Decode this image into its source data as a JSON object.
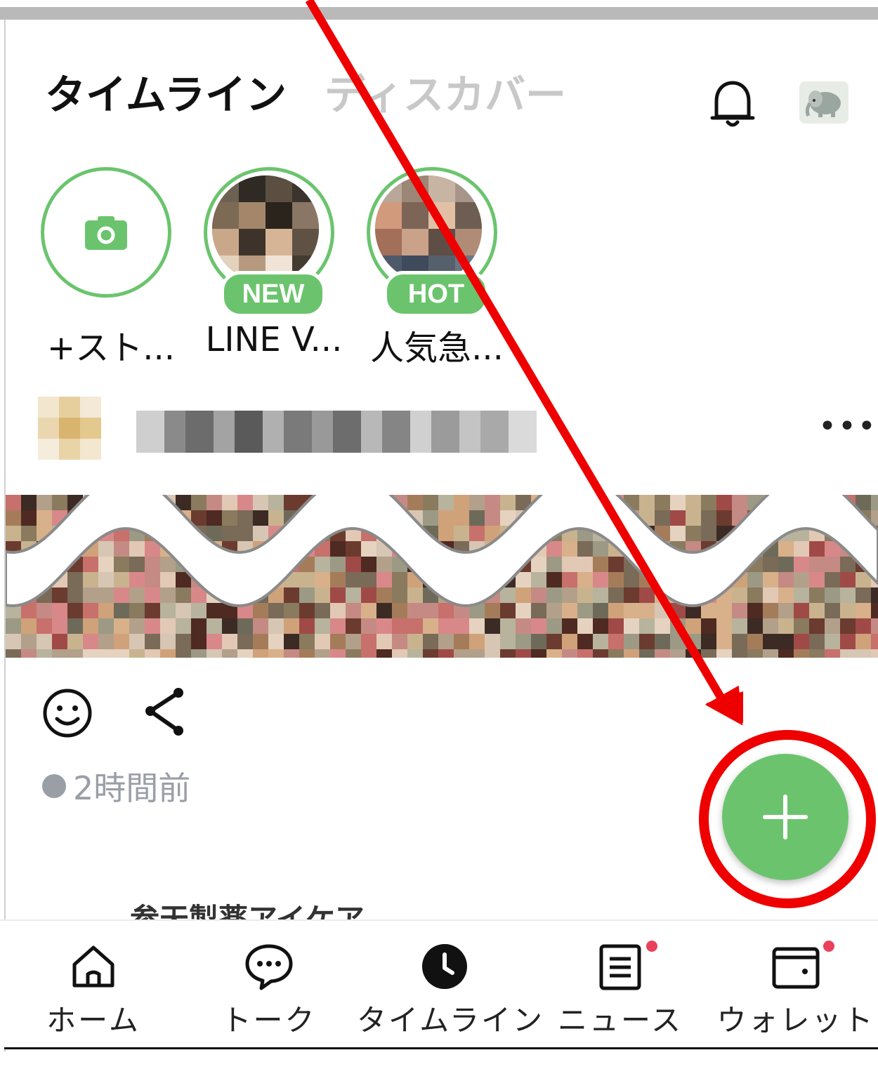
{
  "header": {
    "tab_active": "タイムライン",
    "tab_inactive": "ディスカバー",
    "notification_icon": "bell-icon",
    "avatar_icon": "elephant-avatar"
  },
  "stories": [
    {
      "label": "+スト...",
      "badge": "",
      "kind": "add"
    },
    {
      "label": "LINE V...",
      "badge": "NEW",
      "kind": "story"
    },
    {
      "label": "人気急...",
      "badge": "HOT",
      "kind": "story"
    }
  ],
  "post": {
    "more_label": "•••",
    "timestamp": "2時間前",
    "next_post_peek": "参天製薬アイケア"
  },
  "fab": {
    "label": "+"
  },
  "bottom_nav": [
    {
      "label": "ホーム",
      "icon": "home-icon"
    },
    {
      "label": "トーク",
      "icon": "chat-icon"
    },
    {
      "label": "タイムライン",
      "icon": "clock-icon"
    },
    {
      "label": "ニュース",
      "icon": "news-icon",
      "badge": true
    },
    {
      "label": "ウォレット",
      "icon": "wallet-icon",
      "badge": true
    }
  ],
  "colors": {
    "accent_green": "#6bc46d",
    "annotation_red": "#ee0000",
    "badge_red": "#e9415c"
  }
}
